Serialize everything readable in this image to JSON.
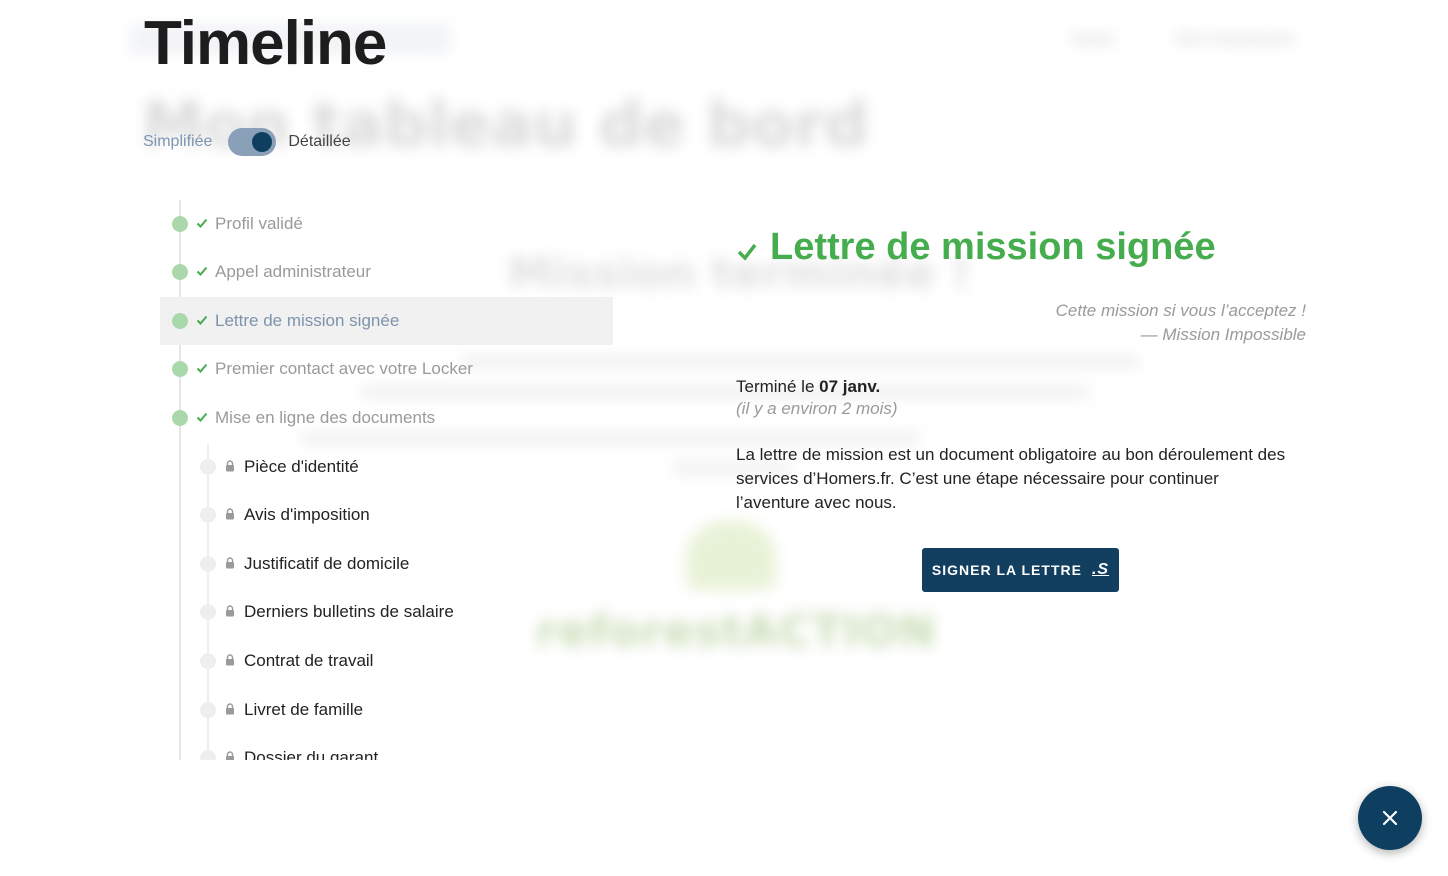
{
  "background": {
    "nav_links": [
      "Notes",
      "Mon Dashboard"
    ],
    "dashboard_title": "Mon tableau de bord",
    "section_title": "Mission terminée !",
    "partner_logo_text": "reforestACTION"
  },
  "header": {
    "title": "Timeline"
  },
  "view_toggle": {
    "left_label": "Simplifiée",
    "right_label": "Détaillée",
    "state": "Détaillée"
  },
  "timeline": {
    "steps": [
      {
        "label": "Profil validé",
        "status": "done"
      },
      {
        "label": "Appel administrateur",
        "status": "done"
      },
      {
        "label": "Lettre de mission signée",
        "status": "done",
        "active": true
      },
      {
        "label": "Premier contact avec votre Locker",
        "status": "done"
      },
      {
        "label": "Mise en ligne des documents",
        "status": "done"
      }
    ],
    "documents": [
      {
        "label": "Pièce d'identité",
        "status": "locked"
      },
      {
        "label": "Avis d'imposition",
        "status": "locked"
      },
      {
        "label": "Justificatif de domicile",
        "status": "locked"
      },
      {
        "label": "Derniers bulletins de salaire",
        "status": "locked"
      },
      {
        "label": "Contrat de travail",
        "status": "locked"
      },
      {
        "label": "Livret de famille",
        "status": "locked"
      },
      {
        "label": "Dossier du garant",
        "status": "locked"
      }
    ]
  },
  "detail": {
    "title": "Lettre de mission signée",
    "quote_line1": "Cette mission si vous l’acceptez !",
    "quote_line2": "— Mission Impossible",
    "done_prefix": "Terminé le",
    "done_date": "07 janv.",
    "ago": "(il y a environ 2 mois)",
    "description": "La lettre de mission est un document obligatoire au bon déroulement des services d’Homers.fr. C’est une étape nécessaire pour continuer l’aventure avec nous.",
    "button_label": "SIGNER LA LETTRE",
    "button_icon": "signature-icon"
  },
  "fab": {
    "icon": "close-icon"
  },
  "colors": {
    "success": "#46ad4f",
    "primary": "#123f60",
    "muted": "#9a9a9a",
    "done_dot": "#a9d9ab"
  }
}
